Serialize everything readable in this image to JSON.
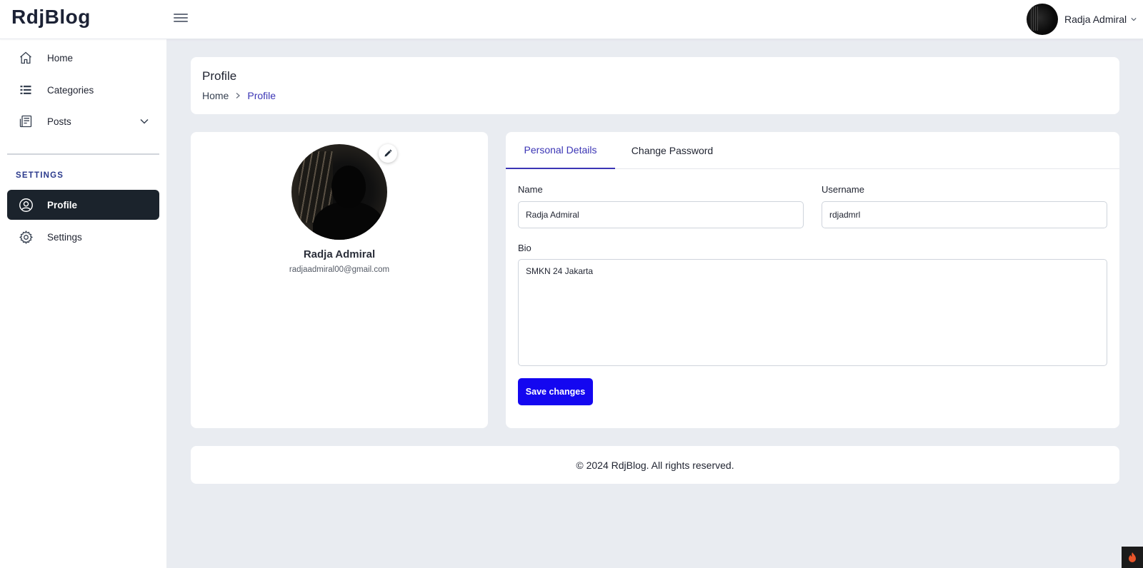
{
  "header": {
    "brand": "RdjBlog",
    "user_name": "Radja Admiral"
  },
  "sidebar": {
    "items": [
      {
        "label": "Home",
        "icon": "home-icon"
      },
      {
        "label": "Categories",
        "icon": "list-icon"
      },
      {
        "label": "Posts",
        "icon": "document-icon"
      }
    ],
    "section_title": "SETTINGS",
    "settings_items": [
      {
        "label": "Profile",
        "icon": "user-circle-icon",
        "active": true
      },
      {
        "label": "Settings",
        "icon": "gear-icon"
      }
    ]
  },
  "page": {
    "title": "Profile",
    "breadcrumb": {
      "home": "Home",
      "current": "Profile"
    }
  },
  "profile": {
    "name": "Radja Admiral",
    "email": "radjaadmiral00@gmail.com"
  },
  "tabs": [
    {
      "label": "Personal Details",
      "active": true
    },
    {
      "label": "Change Password"
    }
  ],
  "form": {
    "name_label": "Name",
    "name_value": "Radja Admiral",
    "username_label": "Username",
    "username_value": "rdjadmrl",
    "bio_label": "Bio",
    "bio_value": "SMKN 24 Jakarta",
    "save_label": "Save changes"
  },
  "footer": {
    "text": "© 2024 RdjBlog. All rights reserved."
  },
  "colors": {
    "accent": "#3b35b5",
    "primary_button": "#1407f0",
    "sidebar_active": "#1b232c",
    "background": "#e9ecf1"
  }
}
